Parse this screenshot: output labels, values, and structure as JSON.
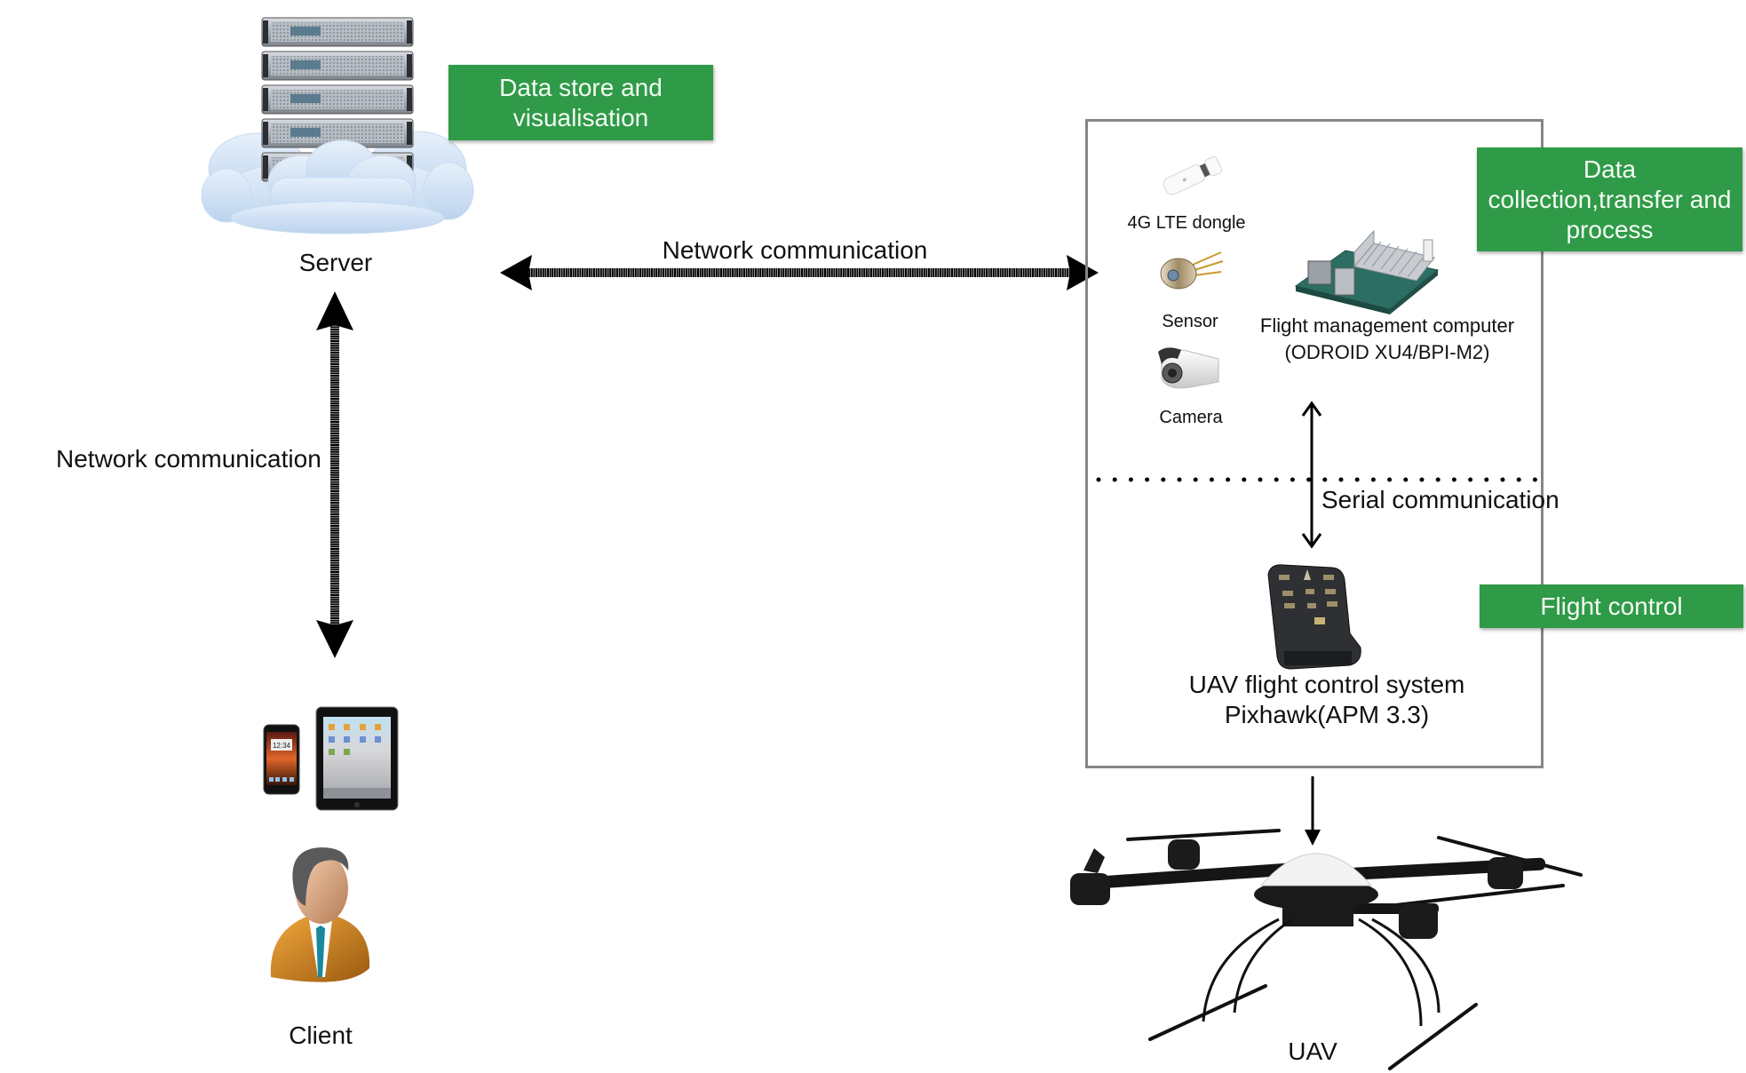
{
  "diagram": {
    "server": {
      "label": "Server"
    },
    "client": {
      "label": "Client",
      "phone_clock": "12:34"
    },
    "uav": {
      "label": "UAV"
    },
    "tags": {
      "data_store": [
        "Data store and",
        "visualisation"
      ],
      "data_collection": [
        "Data",
        "collection,transfer and",
        "process"
      ],
      "flight_control": [
        "Flight control"
      ]
    },
    "links": {
      "server_uav": "Network communication",
      "server_client": "Network communication",
      "serial": "Serial communication"
    },
    "onboard": {
      "dongle": "4G LTE dongle",
      "sensor": "Sensor",
      "camera": "Camera",
      "fmc": [
        "Flight management computer",
        "(ODROID XU4/BPI-M2)"
      ],
      "fcs": [
        "UAV flight control system",
        "Pixhawk(APM 3.3)"
      ]
    },
    "colors": {
      "tag_green": "#2f9a47",
      "box_border": "#85868a",
      "arrow": "#000000"
    }
  }
}
